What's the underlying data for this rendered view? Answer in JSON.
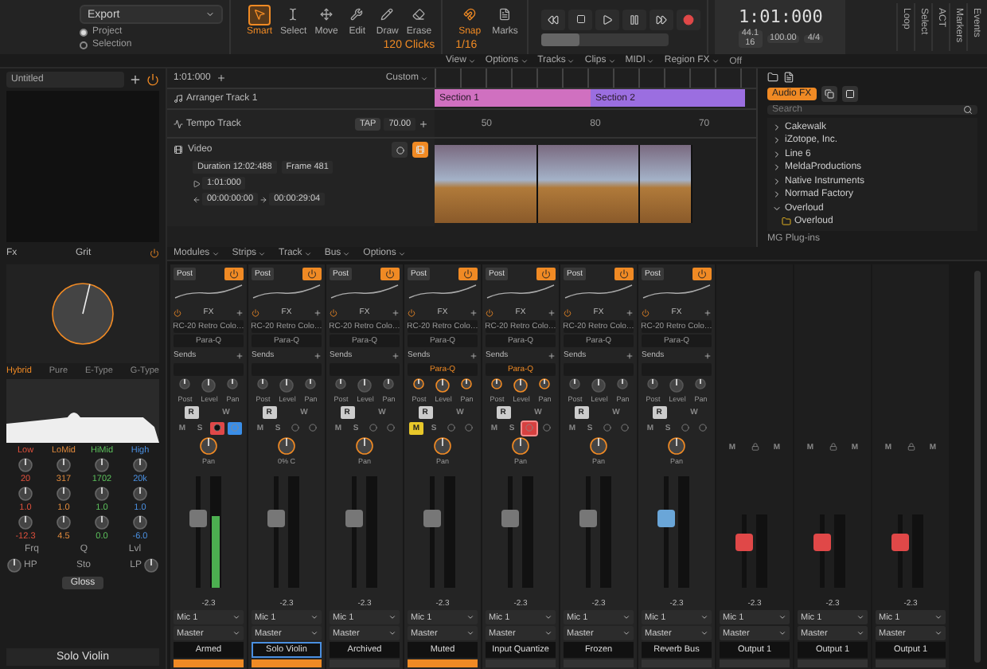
{
  "toolbar": {
    "export": "Export",
    "scope": [
      {
        "label": "Project",
        "selected": true
      },
      {
        "label": "Selection",
        "selected": false
      }
    ],
    "tools": [
      {
        "label": "Smart",
        "selected": true
      },
      {
        "label": "Select",
        "selected": false
      },
      {
        "label": "Move",
        "selected": false
      },
      {
        "label": "Edit",
        "selected": false
      },
      {
        "label": "Draw",
        "selected": false
      },
      {
        "label": "Erase",
        "selected": false
      }
    ],
    "snap_resolution": "120 Clicks",
    "snap": "Snap",
    "snap_value": "1/16",
    "marks": "Marks",
    "time": "1:01:000",
    "sample_rate": "44.1",
    "bit_depth": "16",
    "tempo": "100.00",
    "meter": "4/4",
    "transport": {
      "level": 0.3
    },
    "side_tabs": [
      "Loop",
      "Select",
      "ACT",
      "Markers",
      "Events"
    ]
  },
  "track_menu": [
    "View",
    "Options",
    "Tracks",
    "Clips",
    "MIDI",
    "Region FX"
  ],
  "track_menu_state": "Off",
  "tracks": {
    "now": "1:01:000",
    "layout": "Custom",
    "arranger": {
      "name": "Arranger Track 1",
      "sections": [
        {
          "name": "Section 1",
          "color": "#d070c0"
        },
        {
          "name": "Section 2",
          "color": "#9b6ee0"
        }
      ]
    },
    "tempo": {
      "name": "Tempo Track",
      "tap": "TAP",
      "value": "70.00",
      "points": [
        "50",
        "80",
        "70"
      ]
    },
    "video": {
      "name": "Video",
      "duration_label": "Duration",
      "duration": "12:02:488",
      "frame_label": "Frame",
      "frame": "481",
      "start": "1:01:000",
      "from": "00:00:00:00",
      "to": "00:00:29:04"
    }
  },
  "browser": {
    "category": "Audio FX",
    "search": {
      "placeholder": "Search"
    },
    "items": [
      {
        "label": "Cakewalk",
        "expanded": false
      },
      {
        "label": "iZotope, Inc.",
        "expanded": false
      },
      {
        "label": "Line 6",
        "expanded": false
      },
      {
        "label": "MeldaProductions",
        "expanded": false
      },
      {
        "label": "Native Instruments",
        "expanded": false
      },
      {
        "label": "Normad Factory",
        "expanded": false
      },
      {
        "label": "Overloud",
        "expanded": true,
        "children": [
          {
            "label": "Overloud"
          }
        ]
      }
    ],
    "footer": "MG Plug-ins"
  },
  "inspector": {
    "preset": "Untitled",
    "fx_label": "Fx",
    "plugin": "Grit",
    "drive": {
      "level": 0.55
    },
    "eq_modes": [
      {
        "label": "Hybrid",
        "selected": true
      },
      {
        "label": "Pure",
        "selected": false
      },
      {
        "label": "E-Type",
        "selected": false
      },
      {
        "label": "G-Type",
        "selected": false
      }
    ],
    "bands": [
      {
        "name": "Low",
        "color": "#e0503c",
        "freq": "20",
        "q": "1.0",
        "gain": "-12.3"
      },
      {
        "name": "LoMid",
        "color": "#e08a3c",
        "freq": "317",
        "q": "1.0",
        "gain": "4.5"
      },
      {
        "name": "HiMid",
        "color": "#5cc05c",
        "freq": "1702",
        "q": "1.0",
        "gain": "0.0"
      },
      {
        "name": "High",
        "color": "#4a8fe0",
        "freq": "20k",
        "q": "1.0",
        "gain": "-6.0"
      }
    ],
    "freq_label": "Frq",
    "q_label": "Q",
    "level_label": "Lvl",
    "gloss": "Gloss",
    "hp": "HP",
    "lp": "LP",
    "stereo": "Sto",
    "track": "Solo Violin"
  },
  "mixer": {
    "menu": [
      "Modules",
      "Strips",
      "Track",
      "Bus",
      "Options"
    ],
    "strips": [
      {
        "kind": "track",
        "name": "Armed",
        "selected": false,
        "flagged": true,
        "labels": {
          "post": "Post",
          "fx": "FX",
          "sends": "Sends",
          "knobs": [
            "Post",
            "Level",
            "Pan"
          ],
          "read": "R",
          "write": "W",
          "mute": "M",
          "solo": "S"
        },
        "fx": [
          "RC-20 Retro Colo…",
          "Para-Q"
        ],
        "armed": true,
        "monitor": true,
        "muted": false,
        "iq": false,
        "pan": "Pan",
        "level": 0.62,
        "meter": {
          "level": 0.65
        },
        "value": "-2.3",
        "input": "Mic 1",
        "output": "Master"
      },
      {
        "kind": "track",
        "name": "Solo Violin",
        "selected": true,
        "flagged": true,
        "labels": {
          "post": "Post",
          "fx": "FX",
          "sends": "Sends",
          "knobs": [
            "Post",
            "Level",
            "Pan"
          ],
          "read": "R",
          "write": "W",
          "mute": "M",
          "solo": "S"
        },
        "fx": [
          "RC-20 Retro Colo…",
          "Para-Q"
        ],
        "armed": false,
        "monitor": false,
        "muted": false,
        "iq": false,
        "pan": "0% C",
        "level": 0.62,
        "value": "-2.3",
        "input": "Mic 1",
        "output": "Master"
      },
      {
        "kind": "track",
        "name": "Archived",
        "selected": false,
        "flagged": false,
        "labels": {
          "post": "Post",
          "fx": "FX",
          "sends": "Sends",
          "knobs": [
            "Post",
            "Level",
            "Pan"
          ],
          "read": "R",
          "write": "W",
          "mute": "M",
          "solo": "S"
        },
        "fx": [
          "RC-20 Retro Colo…",
          "Para-Q"
        ],
        "armed": false,
        "monitor": false,
        "muted": false,
        "iq": false,
        "pan": "Pan",
        "level": 0.62,
        "value": "-2.3",
        "input": "Mic 1",
        "output": "Master"
      },
      {
        "kind": "track",
        "name": "Muted",
        "selected": false,
        "flagged": true,
        "labels": {
          "post": "Post",
          "fx": "FX",
          "sends": "Sends",
          "knobs": [
            "Post",
            "Level",
            "Pan"
          ],
          "read": "R",
          "write": "W",
          "mute": "M",
          "solo": "S"
        },
        "fx": [
          "RC-20 Retro Colo…",
          "Para-Q"
        ],
        "send": "Para-Q",
        "armed": false,
        "monitor": false,
        "muted": true,
        "iq": false,
        "pan": "Pan",
        "level": 0.62,
        "value": "-2.3",
        "input": "Mic 1",
        "output": "Master"
      },
      {
        "kind": "track",
        "name": "Input Quantize",
        "selected": false,
        "flagged": false,
        "labels": {
          "post": "Post",
          "fx": "FX",
          "sends": "Sends",
          "knobs": [
            "Post",
            "Level",
            "Pan"
          ],
          "read": "R",
          "write": "W",
          "mute": "M",
          "solo": "S"
        },
        "fx": [
          "RC-20 Retro Colo…",
          "Para-Q"
        ],
        "send": "Para-Q",
        "armed": false,
        "monitor": false,
        "muted": false,
        "iq": true,
        "pan": "Pan",
        "level": 0.62,
        "value": "-2.3",
        "input": "Mic 1",
        "output": "Master"
      },
      {
        "kind": "track",
        "name": "Frozen",
        "selected": false,
        "flagged": false,
        "labels": {
          "post": "Post",
          "fx": "FX",
          "sends": "Sends",
          "knobs": [
            "Post",
            "Level",
            "Pan"
          ],
          "read": "R",
          "write": "W",
          "mute": "M",
          "solo": "S"
        },
        "fx": [
          "RC-20 Retro Colo…",
          "Para-Q"
        ],
        "armed": false,
        "monitor": false,
        "muted": false,
        "iq": false,
        "pan": "Pan",
        "level": 0.62,
        "value": "-2.3",
        "input": "Mic 1",
        "output": "Master"
      },
      {
        "kind": "bus",
        "name": "Reverb Bus",
        "selected": false,
        "flagged": false,
        "labels": {
          "post": "Post",
          "fx": "FX",
          "sends": "Sends",
          "knobs": [
            "Post",
            "Level",
            "Pan"
          ],
          "read": "R",
          "write": "W",
          "mute": "M",
          "solo": "S"
        },
        "fx": [
          "RC-20 Retro Colo…",
          "Para-Q"
        ],
        "armed": false,
        "monitor": false,
        "muted": false,
        "iq": false,
        "pan": "Pan",
        "level": 0.62,
        "value": "-2.3",
        "input": "Mic 1",
        "output": "Master"
      },
      {
        "kind": "output",
        "name": "Output 1",
        "selected": false,
        "flagged": false,
        "labels": {
          "mute": "M",
          "mono": "M"
        },
        "muted": false,
        "level": 0.62,
        "value": "-2.3",
        "input": "Mic 1",
        "output": "Master"
      },
      {
        "kind": "output",
        "name": "Output 1",
        "selected": false,
        "flagged": false,
        "labels": {
          "mute": "M",
          "mono": "M"
        },
        "muted": false,
        "level": 0.62,
        "value": "-2.3",
        "input": "Mic 1",
        "output": "Master"
      },
      {
        "kind": "output",
        "name": "Output 1",
        "selected": false,
        "flagged": false,
        "labels": {
          "mute": "M",
          "mono": "M"
        },
        "muted": false,
        "level": 0.62,
        "value": "-2.3",
        "input": "Mic 1",
        "output": "Master"
      }
    ]
  }
}
